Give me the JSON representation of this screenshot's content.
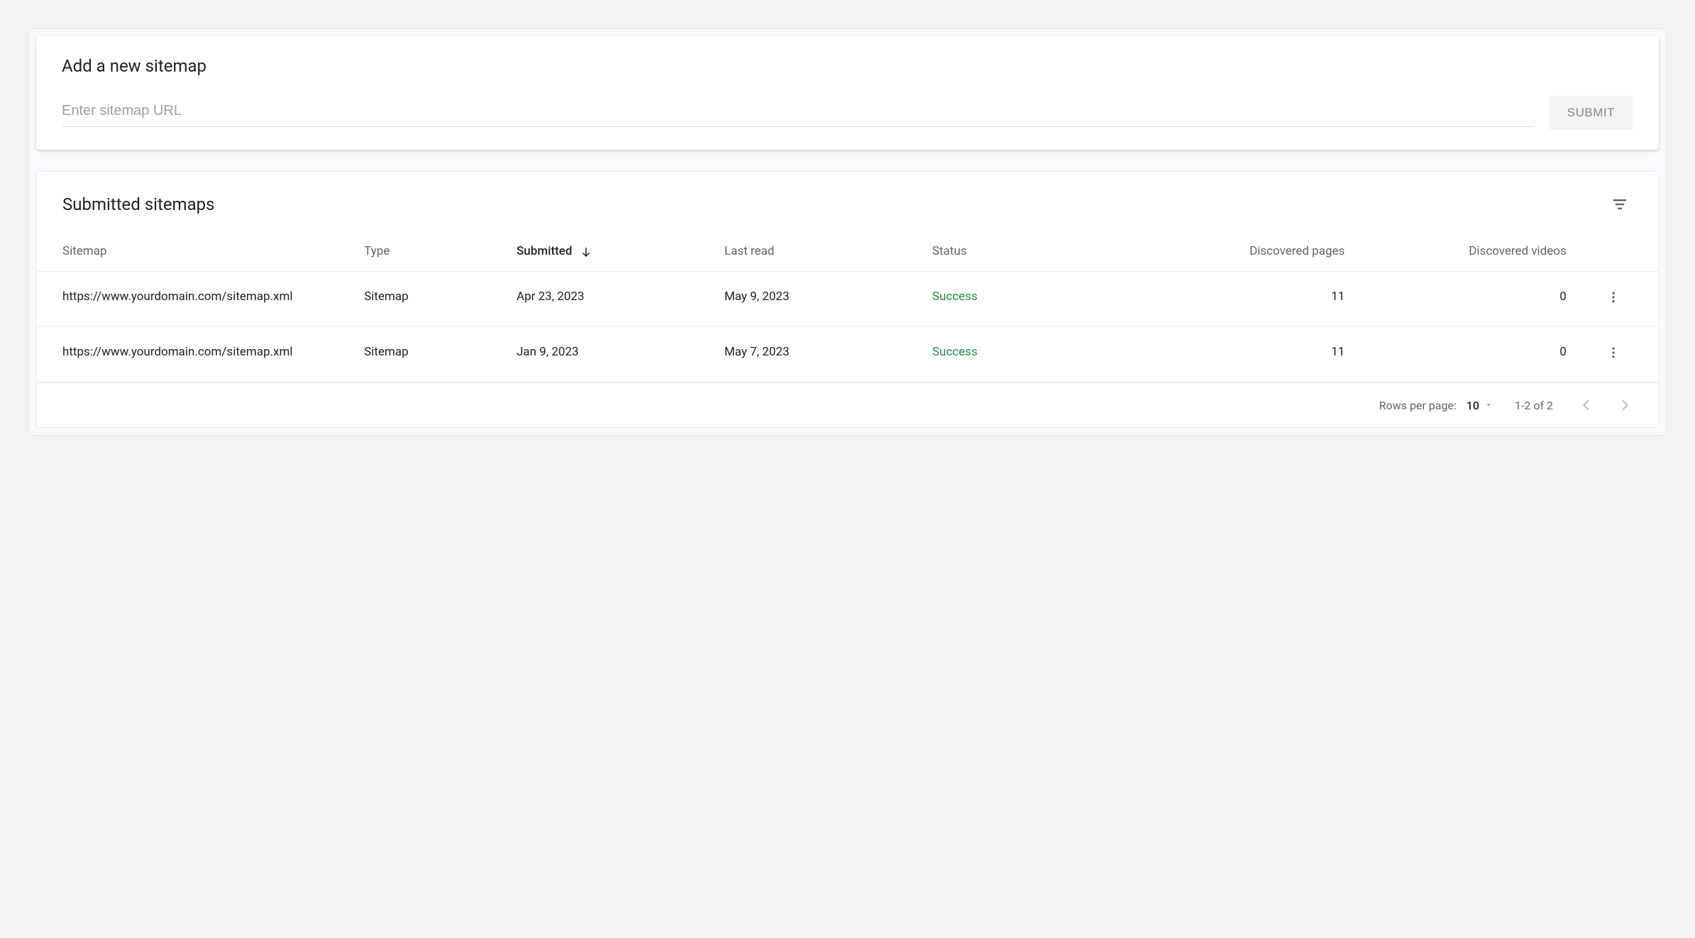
{
  "add": {
    "title": "Add a new sitemap",
    "placeholder": "Enter sitemap URL",
    "submit": "SUBMIT"
  },
  "list": {
    "title": "Submitted sitemaps",
    "columns": {
      "sitemap": "Sitemap",
      "type": "Type",
      "submitted": "Submitted",
      "last_read": "Last read",
      "status": "Status",
      "pages": "Discovered pages",
      "videos": "Discovered videos"
    },
    "sorted_by": "submitted",
    "sort_dir": "desc",
    "rows": [
      {
        "sitemap": "https://www.yourdomain.com/sitemap.xml",
        "type": "Sitemap",
        "submitted": "Apr 23, 2023",
        "last_read": "May 9, 2023",
        "status": "Success",
        "status_kind": "success",
        "pages": "11",
        "videos": "0"
      },
      {
        "sitemap": "https://www.yourdomain.com/sitemap.xml",
        "type": "Sitemap",
        "submitted": "Jan 9, 2023",
        "last_read": "May 7, 2023",
        "status": "Success",
        "status_kind": "success",
        "pages": "11",
        "videos": "0"
      }
    ]
  },
  "footer": {
    "rows_label": "Rows per page:",
    "rows_value": "10",
    "range": "1-2 of 2"
  }
}
